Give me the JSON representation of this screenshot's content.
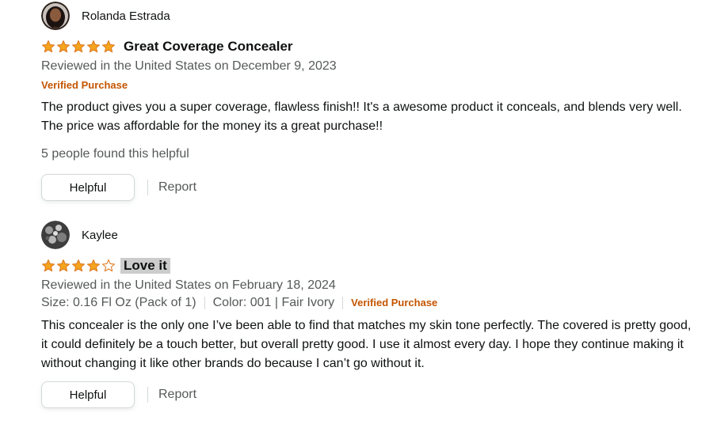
{
  "colors": {
    "star_fill": "#f4a41d",
    "star_outline": "#de7921",
    "verified": "#c45500",
    "secondary_text": "#565959",
    "title_highlight": "#cccccc"
  },
  "reviews": [
    {
      "author": "Rolanda Estrada",
      "avatar_icon": "profile-photo-avatar",
      "rating": 5,
      "rating_max": 5,
      "title": "Great Coverage Concealer",
      "date": "Reviewed in the United States on December 9, 2023",
      "verified_label": "Verified Purchase",
      "body": "The product gives you a super coverage, flawless finish!! It's a awesome product it conceals, and blends very well. The price was affordable for the money its a great purchase!!",
      "helpful_count_text": "5 people found this helpful",
      "helpful_button": "Helpful",
      "report_label": "Report"
    },
    {
      "author": "Kaylee",
      "avatar_icon": "profile-photo-avatar",
      "rating": 4,
      "rating_max": 5,
      "title": "Love it",
      "date": "Reviewed in the United States on February 18, 2024",
      "size": "Size: 0.16 Fl Oz (Pack of 1)",
      "color": "Color: 001 | Fair Ivory",
      "verified_label": "Verified Purchase",
      "body": "This concealer is the only one I’ve been able to find that matches my skin tone perfectly. The covered is pretty good, it could definitely be a touch better, but overall pretty good. I use it almost every day. I hope they continue making it without changing it like other brands do because I can’t go without it.",
      "helpful_button": "Helpful",
      "report_label": "Report"
    }
  ]
}
